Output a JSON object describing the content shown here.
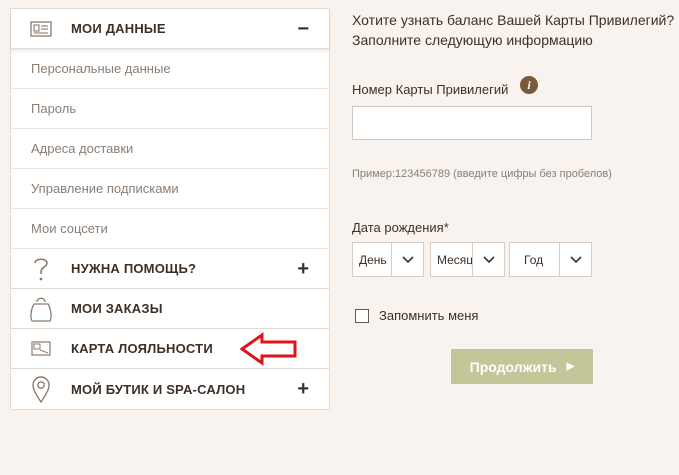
{
  "sidebar": {
    "my_data": {
      "title": "МОИ ДАННЫЕ",
      "toggle": "−",
      "icon": "id-card-icon",
      "items": [
        {
          "label": "Персональные данные"
        },
        {
          "label": "Пароль"
        },
        {
          "label": "Адреса доставки"
        },
        {
          "label": "Управление подписками"
        },
        {
          "label": "Мои соцсети"
        }
      ]
    },
    "help": {
      "title": "НУЖНА ПОМОЩЬ?",
      "toggle": "+",
      "icon": "question-icon"
    },
    "orders": {
      "title": "МОИ ЗАКАЗЫ",
      "icon": "bag-icon"
    },
    "loyalty": {
      "title": "КАРТА ЛОЯЛЬНОСТИ",
      "icon": "card-icon"
    },
    "boutique": {
      "title": "МОЙ БУТИК И SPA-САЛОН",
      "toggle": "+",
      "icon": "location-pin-icon"
    }
  },
  "form": {
    "intro": "Хотите узнать баланс Вашей Карты Привилегий? Заполните следующую информацию",
    "card_label": "Номер Карты Привилегий",
    "info_icon": "i",
    "card_value": "",
    "hint": "Пример:123456789 (введите цифры без пробелов)",
    "dob_label": "Дата рождения*",
    "day": "День",
    "month": "Месяц",
    "year": "Год",
    "remember": "Запомнить меня",
    "submit": "Продолжить"
  },
  "colors": {
    "accent_arrow": "#e0121a",
    "button_bg": "#c5c59a",
    "page_bg": "#f8f3ee"
  }
}
